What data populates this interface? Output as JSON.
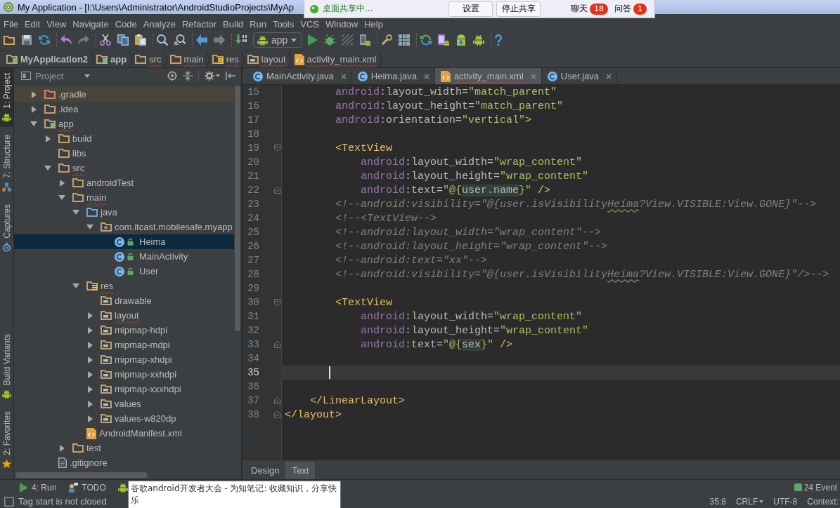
{
  "window": {
    "title": "My Application - [I:\\Users\\Administrator\\AndroidStudioProjects\\MyAp"
  },
  "menu": [
    "File",
    "Edit",
    "View",
    "Navigate",
    "Code",
    "Analyze",
    "Refactor",
    "Build",
    "Run",
    "Tools",
    "VCS",
    "Window",
    "Help"
  ],
  "toolbar": {
    "run_configuration": "app"
  },
  "breadcrumbs": [
    {
      "label": "MyApplication2",
      "kind": "module",
      "misspelled": false
    },
    {
      "label": "app",
      "kind": "module",
      "misspelled": false
    },
    {
      "label": "src",
      "kind": "folder",
      "misspelled": true
    },
    {
      "label": "main",
      "kind": "folder",
      "misspelled": true
    },
    {
      "label": "res",
      "kind": "res-root",
      "misspelled": true
    },
    {
      "label": "layout",
      "kind": "res-folder",
      "misspelled": true
    },
    {
      "label": "activity_main.xml",
      "kind": "xml",
      "misspelled": true
    }
  ],
  "tool_strip": {
    "top": [
      {
        "label": "1: Project",
        "kind": "android",
        "selected": true
      },
      {
        "label": "7: Structure",
        "kind": "structure",
        "selected": false
      },
      {
        "label": "Captures",
        "kind": "captures",
        "selected": false
      }
    ],
    "bottom": [
      {
        "label": "Build Variants",
        "kind": "android",
        "selected": false
      },
      {
        "label": "2: Favorites",
        "kind": "favorites",
        "selected": false
      }
    ]
  },
  "project": {
    "title": "Project",
    "tree": [
      {
        "label": ".gradle",
        "kind": "excluded-folder",
        "expanded": false,
        "selected": false,
        "misspelled": false
      },
      {
        "label": ".idea",
        "kind": "folder",
        "expanded": false,
        "selected": false,
        "misspelled": false
      },
      {
        "label": "app",
        "kind": "module",
        "expanded": true,
        "selected": false,
        "misspelled": true,
        "children": [
          {
            "label": "build",
            "kind": "folder",
            "expanded": false,
            "selected": false,
            "misspelled": false
          },
          {
            "label": "libs",
            "kind": "folder",
            "selected": false,
            "misspelled": false
          },
          {
            "label": "src",
            "kind": "folder",
            "expanded": true,
            "selected": false,
            "misspelled": true,
            "children": [
              {
                "label": "androidTest",
                "kind": "folder",
                "expanded": false,
                "selected": false,
                "misspelled": false
              },
              {
                "label": "main",
                "kind": "folder",
                "expanded": true,
                "selected": false,
                "misspelled": true,
                "children": [
                  {
                    "label": "java",
                    "kind": "source-root",
                    "expanded": true,
                    "selected": false,
                    "misspelled": false,
                    "children": [
                      {
                        "label": "com.itcast.mobilesafe.myapp",
                        "kind": "package",
                        "expanded": true,
                        "selected": false,
                        "misspelled": false,
                        "children": [
                          {
                            "label": "Heima",
                            "kind": "class",
                            "selected": true,
                            "misspelled": false
                          },
                          {
                            "label": "MainActivity",
                            "kind": "class",
                            "selected": false,
                            "misspelled": false
                          },
                          {
                            "label": "User",
                            "kind": "class",
                            "selected": false,
                            "misspelled": false
                          }
                        ]
                      }
                    ]
                  },
                  {
                    "label": "res",
                    "kind": "res-root",
                    "expanded": true,
                    "selected": false,
                    "misspelled": true,
                    "children": [
                      {
                        "label": "drawable",
                        "kind": "res-folder",
                        "selected": false,
                        "misspelled": false
                      },
                      {
                        "label": "layout",
                        "kind": "res-folder",
                        "expanded": false,
                        "selected": false,
                        "misspelled": true
                      },
                      {
                        "label": "mipmap-hdpi",
                        "kind": "res-folder",
                        "expanded": false,
                        "selected": false,
                        "misspelled": false
                      },
                      {
                        "label": "mipmap-mdpi",
                        "kind": "res-folder",
                        "expanded": false,
                        "selected": false,
                        "misspelled": false
                      },
                      {
                        "label": "mipmap-xhdpi",
                        "kind": "res-folder",
                        "expanded": false,
                        "selected": false,
                        "misspelled": false
                      },
                      {
                        "label": "mipmap-xxhdpi",
                        "kind": "res-folder",
                        "expanded": false,
                        "selected": false,
                        "misspelled": false
                      },
                      {
                        "label": "mipmap-xxxhdpi",
                        "kind": "res-folder",
                        "expanded": false,
                        "selected": false,
                        "misspelled": false
                      },
                      {
                        "label": "values",
                        "kind": "res-folder",
                        "expanded": false,
                        "selected": false,
                        "misspelled": false
                      },
                      {
                        "label": "values-w820dp",
                        "kind": "res-folder",
                        "expanded": false,
                        "selected": false,
                        "misspelled": false
                      }
                    ]
                  },
                  {
                    "label": "AndroidManifest.xml",
                    "kind": "manifest",
                    "selected": false,
                    "misspelled": false
                  }
                ]
              },
              {
                "label": "test",
                "kind": "folder",
                "expanded": false,
                "selected": false,
                "misspelled": false
              }
            ]
          },
          {
            "label": ".gitignore",
            "kind": "file",
            "selected": false,
            "misspelled": false
          }
        ]
      }
    ]
  },
  "editor": {
    "tabs": [
      {
        "label": "MainActivity.java",
        "kind": "class",
        "selected": false,
        "misspelled": false
      },
      {
        "label": "Heima.java",
        "kind": "class",
        "selected": false,
        "misspelled": false
      },
      {
        "label": "activity_main.xml",
        "kind": "xml",
        "selected": true,
        "misspelled": true
      },
      {
        "label": "User.java",
        "kind": "class",
        "selected": false,
        "misspelled": false
      }
    ],
    "lines": [
      {
        "number": "15",
        "current": false,
        "tokens": [
          {
            "kind": "ns",
            "text": "        android"
          },
          {
            "kind": "attr",
            "text": ":layout_width="
          },
          {
            "kind": "string",
            "text": "\"match_parent\""
          }
        ]
      },
      {
        "number": "16",
        "current": false,
        "tokens": [
          {
            "kind": "ns",
            "text": "        android"
          },
          {
            "kind": "attr",
            "text": ":layout_height="
          },
          {
            "kind": "string",
            "text": "\"match_parent\""
          }
        ]
      },
      {
        "number": "17",
        "current": false,
        "tokens": [
          {
            "kind": "ns",
            "text": "        android"
          },
          {
            "kind": "attr",
            "text": ":orientation="
          },
          {
            "kind": "string",
            "text": "\"vertical\""
          },
          {
            "kind": "tag",
            "text": ">"
          }
        ]
      },
      {
        "number": "18",
        "current": false
      },
      {
        "number": "19",
        "current": false,
        "fold": {
          "kind": "start"
        },
        "tokens": [
          {
            "kind": "tag",
            "text": "        <TextView"
          }
        ]
      },
      {
        "number": "20",
        "current": false,
        "tokens": [
          {
            "kind": "ns",
            "text": "            android"
          },
          {
            "kind": "attr",
            "text": ":layout_width="
          },
          {
            "kind": "string",
            "text": "\"wrap_content\""
          }
        ]
      },
      {
        "number": "21",
        "current": false,
        "tokens": [
          {
            "kind": "ns",
            "text": "            android"
          },
          {
            "kind": "attr",
            "text": ":layout_height="
          },
          {
            "kind": "string",
            "text": "\"wrap_content\""
          }
        ]
      },
      {
        "number": "22",
        "current": false,
        "fold": {
          "kind": "end"
        },
        "tokens": [
          {
            "kind": "ns",
            "text": "            android"
          },
          {
            "kind": "attr",
            "text": ":text="
          },
          {
            "kind": "string",
            "text": "\"@{"
          },
          {
            "kind": "ref",
            "text": "user.name"
          },
          {
            "kind": "string",
            "text": "}\""
          },
          {
            "kind": "tag",
            "text": " />"
          }
        ]
      },
      {
        "number": "23",
        "current": false,
        "tokens": [
          {
            "kind": "comment",
            "text": "        <!--android:visibility=\"@{user.isVisibility"
          },
          {
            "kind": "typo",
            "text": "Heima"
          },
          {
            "kind": "comment",
            "text": "?View.VISIBLE:View.GONE}\"-->"
          }
        ]
      },
      {
        "number": "24",
        "current": false,
        "tokens": [
          {
            "kind": "comment",
            "text": "        <!--<TextView-->"
          }
        ]
      },
      {
        "number": "25",
        "current": false,
        "tokens": [
          {
            "kind": "comment",
            "text": "        <!--android:layout_width=\"wrap_content\"-->"
          }
        ]
      },
      {
        "number": "26",
        "current": false,
        "tokens": [
          {
            "kind": "comment",
            "text": "        <!--android:layout_height=\"wrap_content\"-->"
          }
        ]
      },
      {
        "number": "27",
        "current": false,
        "tokens": [
          {
            "kind": "comment",
            "text": "        <!--android:text=\"xx\"-->"
          }
        ]
      },
      {
        "number": "28",
        "current": false,
        "tokens": [
          {
            "kind": "comment",
            "text": "        <!--android:visibility=\"@{user.isVisibility"
          },
          {
            "kind": "typo",
            "text": "Heima"
          },
          {
            "kind": "comment",
            "text": "?View.VISIBLE:View.GONE}\"/>-->"
          }
        ]
      },
      {
        "number": "29",
        "current": false
      },
      {
        "number": "30",
        "current": false,
        "fold": {
          "kind": "start"
        },
        "tokens": [
          {
            "kind": "tag",
            "text": "        <TextView"
          }
        ]
      },
      {
        "number": "31",
        "current": false,
        "tokens": [
          {
            "kind": "ns",
            "text": "            android"
          },
          {
            "kind": "attr",
            "text": ":layout_width="
          },
          {
            "kind": "string",
            "text": "\"wrap_content\""
          }
        ]
      },
      {
        "number": "32",
        "current": false,
        "tokens": [
          {
            "kind": "ns",
            "text": "            android"
          },
          {
            "kind": "attr",
            "text": ":layout_height="
          },
          {
            "kind": "string",
            "text": "\"wrap_content\""
          }
        ]
      },
      {
        "number": "33",
        "current": false,
        "fold": {
          "kind": "end"
        },
        "tokens": [
          {
            "kind": "ns",
            "text": "            android"
          },
          {
            "kind": "attr",
            "text": ":text="
          },
          {
            "kind": "string",
            "text": "\"@{"
          },
          {
            "kind": "ref",
            "text": "sex"
          },
          {
            "kind": "string",
            "text": "}\""
          },
          {
            "kind": "tag",
            "text": " />"
          }
        ]
      },
      {
        "number": "34",
        "current": false
      },
      {
        "number": "35",
        "current": true
      },
      {
        "number": "36",
        "current": false
      },
      {
        "number": "37",
        "current": false,
        "fold": {
          "kind": "end"
        },
        "tokens": [
          {
            "kind": "tag",
            "text": "    </LinearLayout>"
          }
        ]
      },
      {
        "number": "38",
        "current": false,
        "fold": {
          "kind": "end"
        },
        "tokens": [
          {
            "kind": "tag",
            "text": "</layout>"
          }
        ]
      }
    ],
    "view_tabs": [
      {
        "label": "Design",
        "selected": false
      },
      {
        "label": "Text",
        "selected": true
      }
    ]
  },
  "tool_windows": [
    {
      "label": "4: Run",
      "kind": "run"
    },
    {
      "label": "TODO",
      "kind": "todo"
    },
    {
      "kind": "android"
    }
  ],
  "event_log": "24 Event",
  "status_bar": {
    "message": "Tag start is not closed",
    "position": "35:8",
    "line_separator": "CRLF",
    "encoding": "UTF-8",
    "context": "Context:"
  },
  "screen_share": {
    "status": "桌面共享中...",
    "buttons": [
      "设置",
      "停止共享"
    ],
    "counters": [
      {
        "label": "聊天",
        "count": "18"
      },
      {
        "label": "问答",
        "count": "1"
      }
    ]
  },
  "tooltip": {
    "text": "谷歌android开发者大会 - 为知笔记: 收藏知识，分享快乐"
  }
}
